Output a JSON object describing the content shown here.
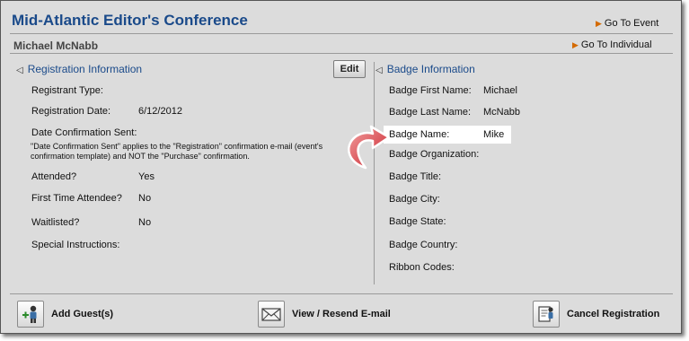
{
  "header": {
    "title": "Mid-Atlantic Editor's Conference",
    "go_to_event": "Go To Event",
    "individual_name": "Michael McNabb",
    "go_to_individual": "Go To Individual"
  },
  "registration": {
    "heading": "Registration Information",
    "edit_label": "Edit",
    "registrant_type_label": "Registrant Type:",
    "registrant_type_value": "",
    "registration_date_label": "Registration Date:",
    "registration_date_value": "6/12/2012",
    "date_confirmation_label": "Date Confirmation Sent:",
    "date_confirmation_value": "",
    "note": "\"Date Confirmation Sent\" applies to the \"Registration\" confirmation e-mail (event's confirmation template) and NOT the \"Purchase\" confirmation.",
    "attended_label": "Attended?",
    "attended_value": "Yes",
    "first_time_label": "First Time Attendee?",
    "first_time_value": "No",
    "waitlisted_label": "Waitlisted?",
    "waitlisted_value": "No",
    "special_instructions_label": "Special Instructions:",
    "special_instructions_value": ""
  },
  "badge": {
    "heading": "Badge Information",
    "first_name_label": "Badge First Name:",
    "first_name_value": "Michael",
    "last_name_label": "Badge Last Name:",
    "last_name_value": "McNabb",
    "badge_name_label": "Badge Name:",
    "badge_name_value": "Mike",
    "organization_label": "Badge Organization:",
    "title_label": "Badge Title:",
    "city_label": "Badge City:",
    "state_label": "Badge State:",
    "country_label": "Badge Country:",
    "ribbon_label": "Ribbon Codes:"
  },
  "actions": {
    "add_guests": "Add Guest(s)",
    "view_resend": "View / Resend E-mail",
    "cancel_registration": "Cancel Registration"
  },
  "colors": {
    "title": "#1a4a8a",
    "panel": "#dcdcdc",
    "arrow": "#e03a3a",
    "link_arrow": "#d46a00"
  }
}
